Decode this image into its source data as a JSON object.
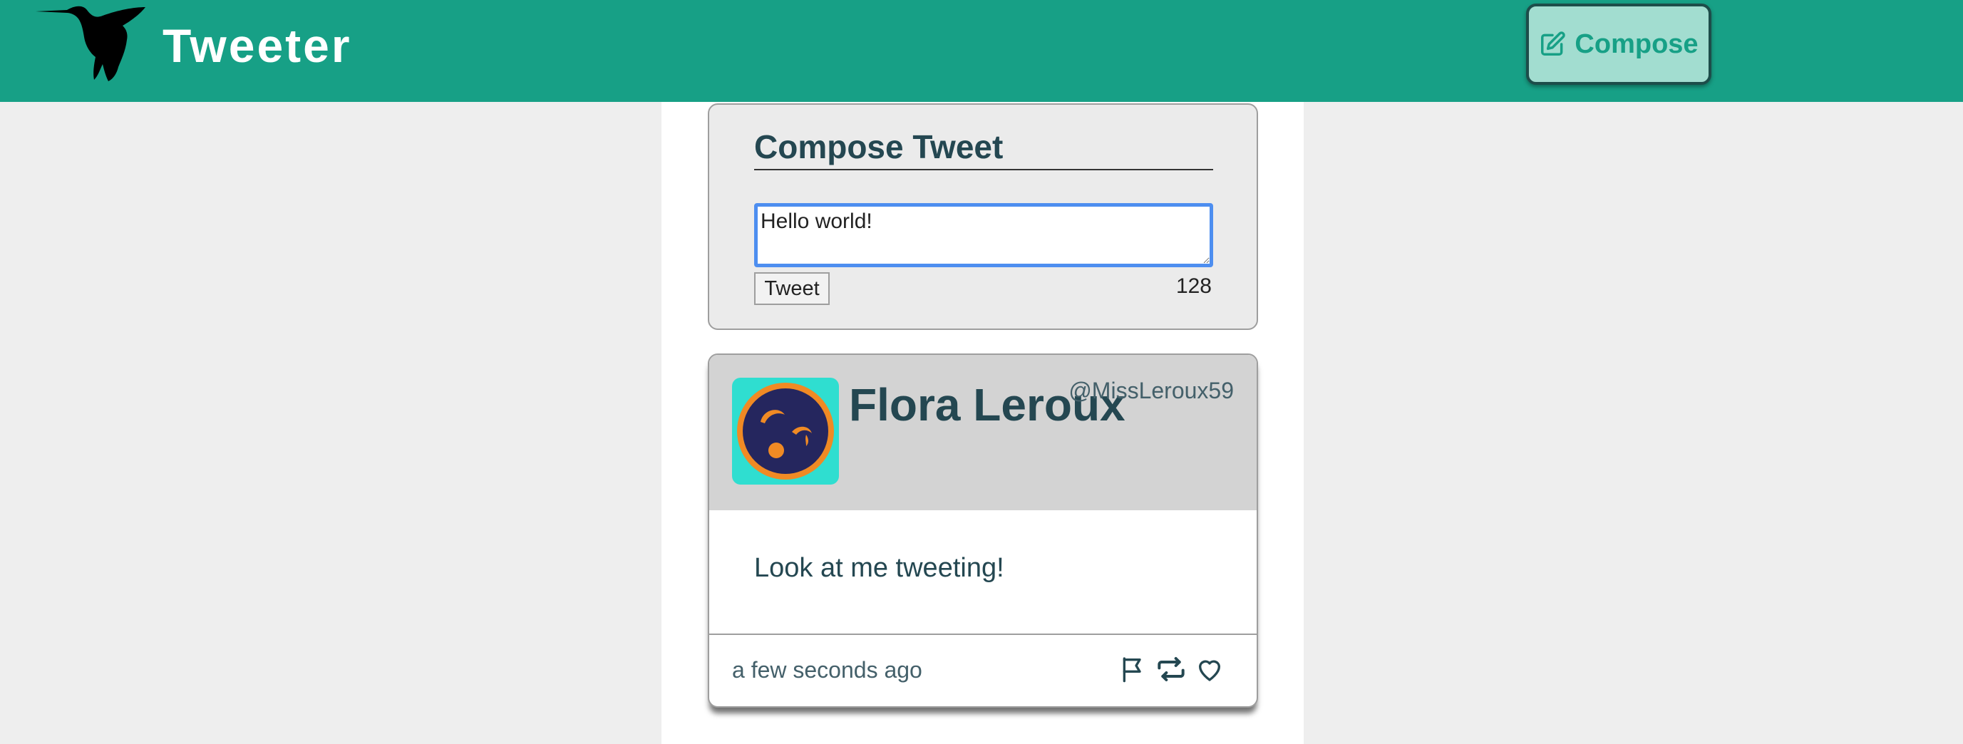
{
  "header": {
    "brand": "Tweeter",
    "compose_button_label": "Compose"
  },
  "compose": {
    "title": "Compose Tweet",
    "textarea_value": "Hello world!",
    "submit_label": "Tweet",
    "char_counter": "128"
  },
  "tweet": {
    "name": "Flora Leroux",
    "handle": "@MissLeroux59",
    "text": "Look at me tweeting!",
    "time_ago": "a few seconds ago",
    "action_icons": [
      "flag-icon",
      "retweet-icon",
      "heart-icon"
    ]
  },
  "colors": {
    "header_bg": "#17a086",
    "compose_button_bg": "#a2ddd0",
    "text_primary": "#244751",
    "focus_ring": "#4d8ef0",
    "avatar_bg": "#2fded0",
    "avatar_orange": "#f08a24",
    "avatar_navy": "#25265e"
  },
  "icons": {
    "logo": "hummingbird-logo",
    "compose": "edit-icon"
  }
}
